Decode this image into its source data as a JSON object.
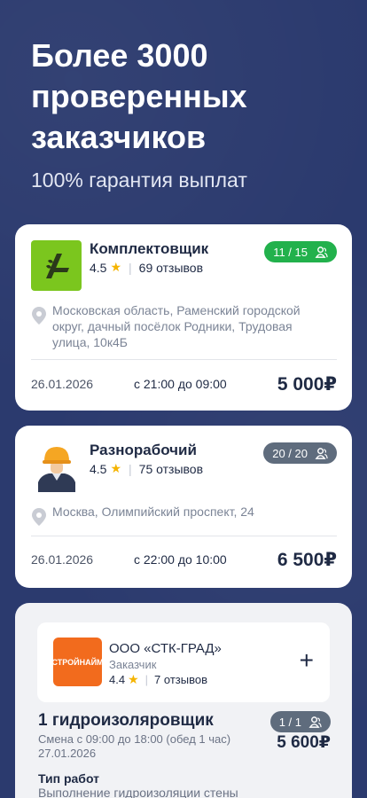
{
  "hero": {
    "title": "Более 3000 проверенных заказчиков",
    "subtitle": "100% гарантия выплат"
  },
  "jobs": [
    {
      "title": "Комплектовщик",
      "rating": "4.5",
      "reviews": "69 отзывов",
      "slots": "11 / 15",
      "slots_color": "#22b14c",
      "location": "Московская область, Раменский городской округ, дачный посёлок Родники, Трудовая улица, 10к4Б",
      "date": "26.01.2026",
      "time": "с 21:00 до 09:00",
      "price": "5 000₽"
    },
    {
      "title": "Разнорабочий",
      "rating": "4.5",
      "reviews": "75 отзывов",
      "slots": "20 / 20",
      "slots_color": "#5f6c7d",
      "location": "Москва, Олимпийский проспект, 24",
      "date": "26.01.2026",
      "time": "с 22:00 до 10:00",
      "price": "6 500₽"
    }
  ],
  "offer": {
    "company": "ООО «СТК-ГРАД»",
    "company_role": "Заказчик",
    "logo_text": "СТРОЙНАЙМ",
    "rating": "4.4",
    "reviews": "7 отзывов",
    "job_title": "1 гидроизоляровщик",
    "shift": "Смена с 09:00 до 18:00 (обед 1 час)",
    "date": "27.01.2026",
    "slots": "1 / 1",
    "price": "5 600₽",
    "work_type_label": "Тип работ",
    "work_type_value": "Выполнение гидроизоляции стены"
  },
  "icons": {
    "users": "users-icon",
    "pin": "location-pin-icon",
    "star": "star-icon",
    "plus": "plus-icon"
  }
}
